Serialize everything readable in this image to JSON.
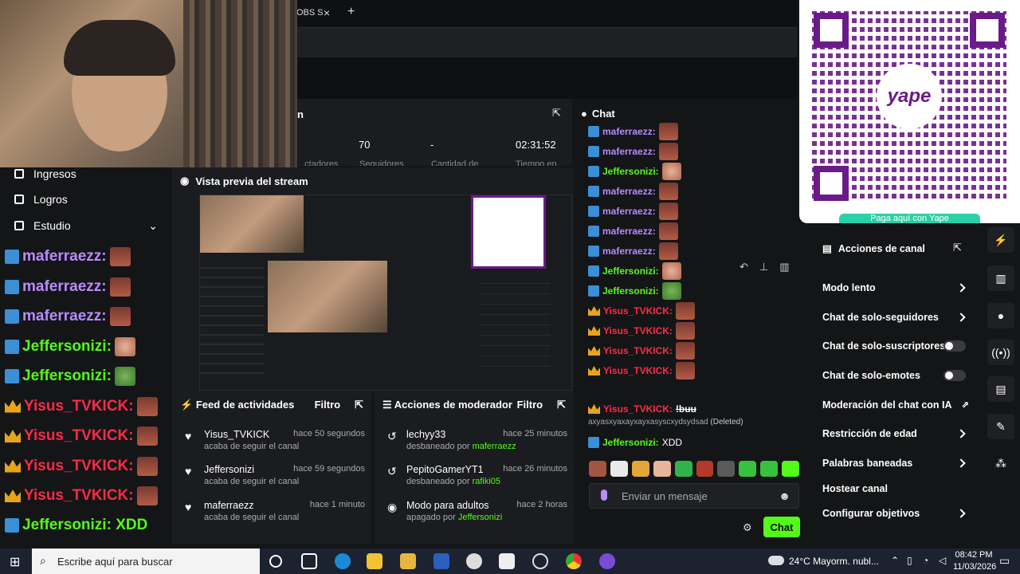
{
  "browser": {
    "tab_label": "OBS S",
    "close_icon": "×",
    "new_tab_icon": "+"
  },
  "stats": {
    "title": "n",
    "values": [
      "70",
      "-",
      "02:31:52"
    ],
    "labels": [
      "...ctadores",
      "Seguidores",
      "Cantidad de",
      "Tiempo en"
    ]
  },
  "leftnav": {
    "items": [
      "Ingresos",
      "Logros",
      "Estudio"
    ]
  },
  "bigchat": {
    "lines": [
      {
        "user": "maferraezz:",
        "color": "#b98bff",
        "badge": "sword"
      },
      {
        "user": "maferraezz:",
        "color": "#b98bff",
        "badge": "sword"
      },
      {
        "user": "maferraezz:",
        "color": "#b98bff",
        "badge": "sword"
      },
      {
        "user": "Jeffersonizi:",
        "color": "#53fc18",
        "badge": "sword"
      },
      {
        "user": "Jeffersonizi:",
        "color": "#53fc18",
        "badge": "sword"
      },
      {
        "user": "Yisus_TVKICK:",
        "color": "#ff2a45",
        "badge": "crown"
      },
      {
        "user": "Yisus_TVKICK:",
        "color": "#ff2a45",
        "badge": "crown"
      },
      {
        "user": "Yisus_TVKICK:",
        "color": "#ff2a45",
        "badge": "crown"
      },
      {
        "user": "Yisus_TVKICK:",
        "color": "#ff2a45",
        "badge": "crown"
      },
      {
        "user": "Jeffersonizi: XDD",
        "color": "#53fc18",
        "badge": "sword"
      }
    ]
  },
  "preview": {
    "title": "Vista previa del stream"
  },
  "feed": {
    "title": "Feed de actividades",
    "filter": "Filtro",
    "items": [
      {
        "name": "Yisus_TVKICK",
        "time": "hace 50 segundos",
        "sub": "acaba de seguir el canal"
      },
      {
        "name": "Jeffersonizi",
        "time": "hace 59 segundos",
        "sub": "acaba de seguir el canal"
      },
      {
        "name": "maferraezz",
        "time": "hace 1 minuto",
        "sub": "acaba de seguir el canal"
      }
    ]
  },
  "mod": {
    "title": "Acciones de moderador",
    "filter": "Filtro",
    "items": [
      {
        "name": "lechyy33",
        "time": "hace 25 minutos",
        "pre": "desbaneado por ",
        "by": "maferraezz"
      },
      {
        "name": "PepitoGamerYT1",
        "time": "hace 26 minutos",
        "pre": "desbaneado por ",
        "by": "rafiki05"
      },
      {
        "name": "Modo para adultos",
        "time": "hace 2 horas",
        "pre": "apagado por ",
        "by": "Jeffersonizi"
      }
    ]
  },
  "chat": {
    "title": "Chat",
    "lines": [
      {
        "user": "maferraezz:",
        "color": "#b98bff"
      },
      {
        "user": "maferraezz:",
        "color": "#b98bff"
      },
      {
        "user": "Jeffersonizi:",
        "color": "#53fc18"
      },
      {
        "user": "maferraezz:",
        "color": "#b98bff"
      },
      {
        "user": "maferraezz:",
        "color": "#b98bff"
      },
      {
        "user": "maferraezz:",
        "color": "#b98bff"
      },
      {
        "user": "maferraezz:",
        "color": "#b98bff"
      },
      {
        "user": "Jeffersonizi:",
        "color": "#53fc18"
      },
      {
        "user": "Jeffersonizi:",
        "color": "#53fc18"
      },
      {
        "user": "Yisus_TVKICK:",
        "color": "#ff2a45"
      },
      {
        "user": "Yisus_TVKICK:",
        "color": "#ff2a45"
      },
      {
        "user": "Yisus_TVKICK:",
        "color": "#ff2a45"
      },
      {
        "user": "Yisus_TVKICK:",
        "color": "#ff2a45"
      }
    ],
    "deleted_user": "Yisus_TVKICK:",
    "deleted_msg": "!buu",
    "deleted_text": "axyasxyaxayxayxasyscxydsydsad",
    "deleted_tag": "(Deleted)",
    "last_user": "Jeffersonizi:",
    "last_msg": "XDD",
    "input_placeholder": "Enviar un mensaje",
    "send_label": "Chat"
  },
  "qr": {
    "brand": "yape",
    "caption": "Paga aquí con Yape"
  },
  "actions": {
    "title": "Acciones de canal",
    "items": [
      "Modo lento",
      "Chat de solo-seguidores",
      "Chat de solo-suscriptores",
      "Chat de solo-emotes",
      "Moderación del chat con IA",
      "Restricción de edad",
      "Palabras baneadas",
      "Hostear canal",
      "Configurar objetivos"
    ]
  },
  "taskbar": {
    "search_placeholder": "Escribe aquí para buscar",
    "weather": "24°C  Mayorm. nubl...",
    "time": "08:42 PM",
    "date": "11/03/2026"
  },
  "colors": {
    "accent": "#53fc18",
    "purple": "#b98bff",
    "red": "#ff2a45",
    "yape": "#6b1a8a"
  }
}
